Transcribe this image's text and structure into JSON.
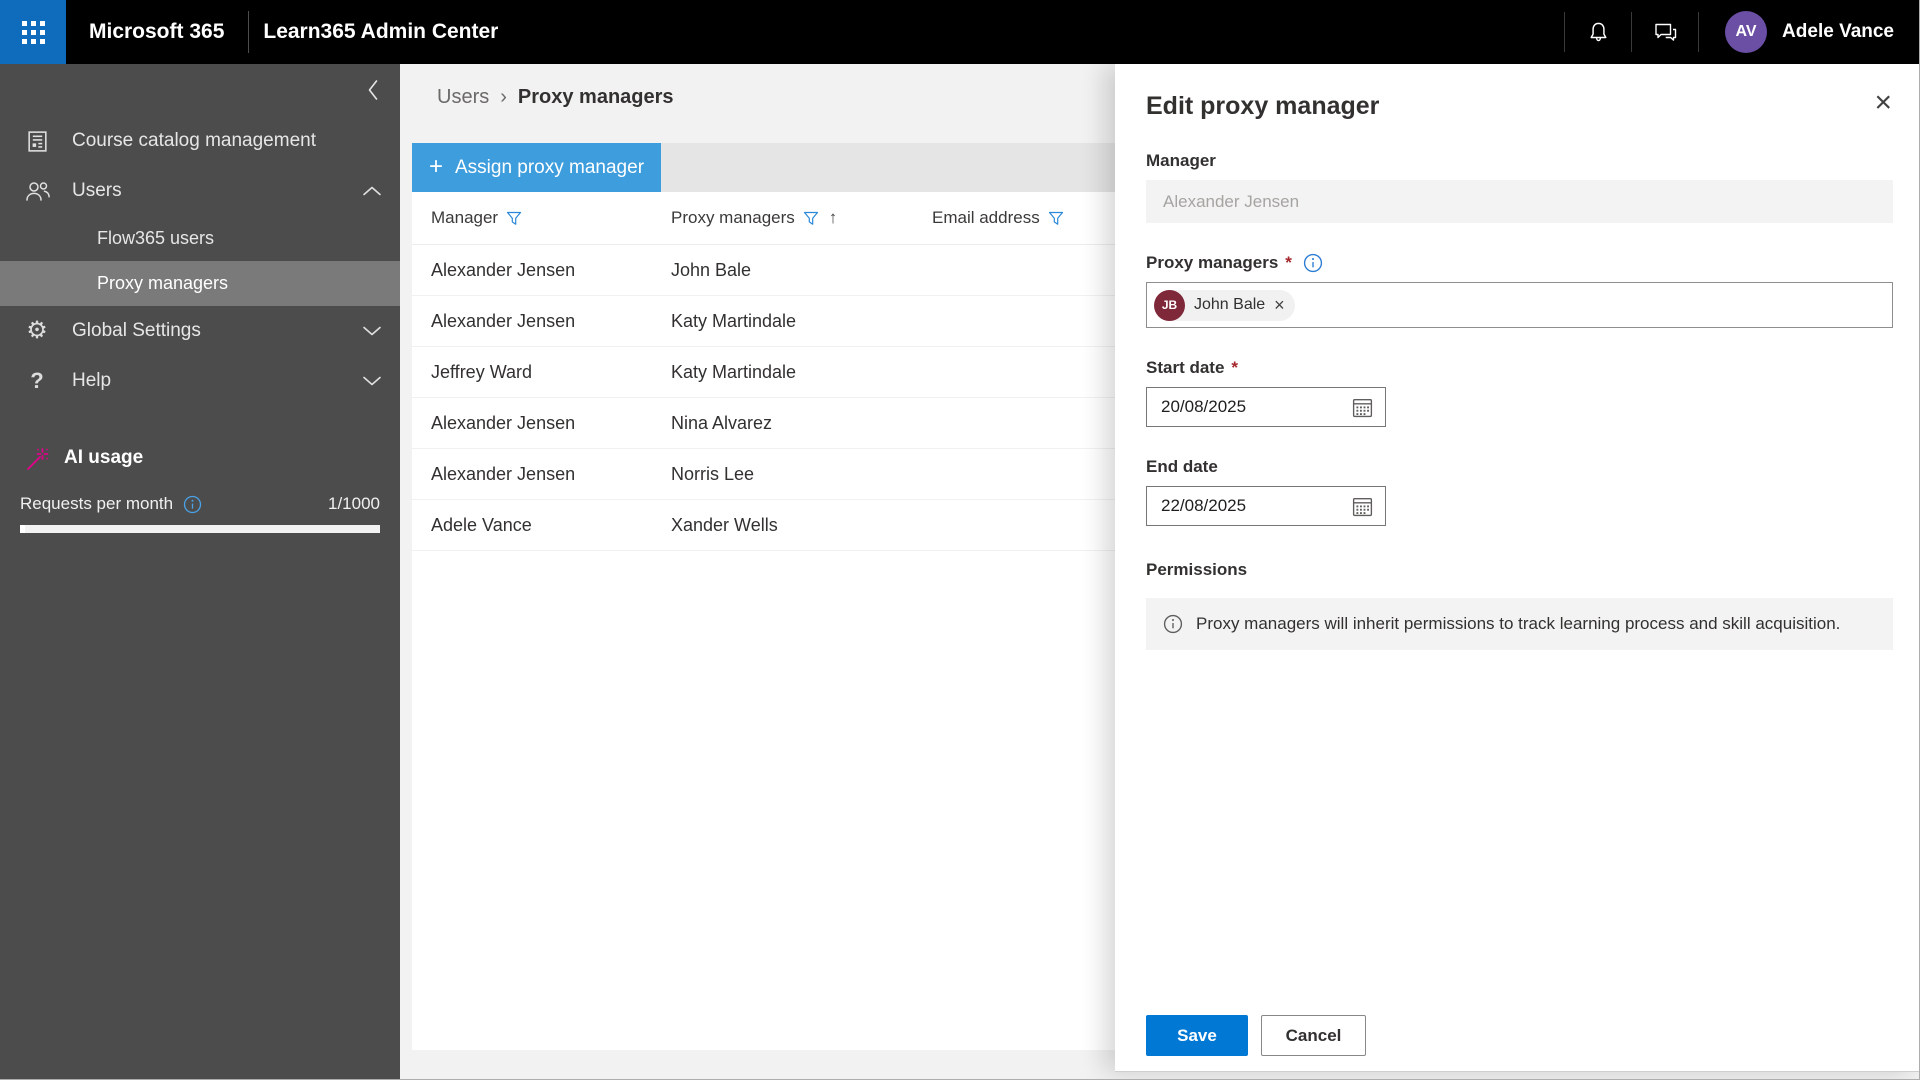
{
  "topbar": {
    "brand": "Microsoft 365",
    "app_title": "Learn365 Admin Center",
    "user_initials": "AV",
    "user_name": "Adele Vance"
  },
  "sidebar": {
    "course_catalog": "Course catalog management",
    "users": "Users",
    "flow365_users": "Flow365 users",
    "proxy_managers": "Proxy managers",
    "global_settings": "Global Settings",
    "help": "Help",
    "help_glyph": "?",
    "gear_glyph": "⚙",
    "ai_usage": "AI usage",
    "requests_label": "Requests per month",
    "requests_value": "1/1000"
  },
  "breadcrumb": {
    "parent": "Users",
    "separator": "›",
    "current": "Proxy managers"
  },
  "toolbar": {
    "plus": "+",
    "assign_label": "Assign proxy manager"
  },
  "table": {
    "columns": [
      "Manager",
      "Proxy managers",
      "Email address"
    ],
    "sort_icon": "↑",
    "rows": [
      {
        "manager": "Alexander Jensen",
        "proxy": "John Bale"
      },
      {
        "manager": "Alexander Jensen",
        "proxy": "Katy Martindale"
      },
      {
        "manager": "Jeffrey Ward",
        "proxy": "Katy Martindale"
      },
      {
        "manager": "Alexander Jensen",
        "proxy": "Nina Alvarez"
      },
      {
        "manager": "Alexander Jensen",
        "proxy": "Norris Lee"
      },
      {
        "manager": "Adele Vance",
        "proxy": "Xander Wells"
      }
    ]
  },
  "panel": {
    "title": "Edit proxy manager",
    "close_glyph": "×",
    "manager_label": "Manager",
    "manager_value": "Alexander Jensen",
    "proxy_label": "Proxy managers",
    "required_mark": "*",
    "chip_initials": "JB",
    "chip_name": "John Bale",
    "chip_remove_glyph": "×",
    "start_date_label": "Start date",
    "start_date_value": "20/08/2025",
    "end_date_label": "End date",
    "end_date_value": "22/08/2025",
    "permissions_label": "Permissions",
    "permissions_note": "Proxy managers will inherit permissions to track learning process and skill acquisition.",
    "save_label": "Save",
    "cancel_label": "Cancel"
  },
  "colors": {
    "accent_blue": "#0078d4",
    "assign_button_blue": "#3e9ddd",
    "waffle_blue": "#0f6cbd",
    "avatar_purple": "#6b4fa5",
    "chip_avatar_maroon": "#7e2839",
    "ai_icon_magenta": "#e3008c",
    "filter_icon_blue": "#2b88d8",
    "sidebar_gray": "#4c4c4c",
    "selected_item_gray": "#7a7a7a"
  }
}
